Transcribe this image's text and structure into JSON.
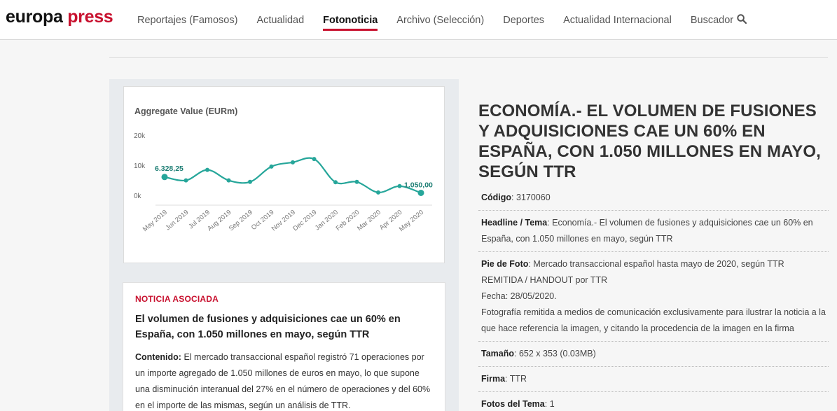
{
  "logo": {
    "part1": "europa ",
    "part2": "press"
  },
  "nav": {
    "items": [
      {
        "label": "Reportajes (Famosos)"
      },
      {
        "label": "Actualidad"
      },
      {
        "label": "Fotonoticia"
      },
      {
        "label": "Archivo (Selección)"
      },
      {
        "label": "Deportes"
      },
      {
        "label": "Actualidad Internacional"
      },
      {
        "label": "Buscador"
      }
    ],
    "active_index": 2
  },
  "chart_data": {
    "type": "line",
    "title": "Aggregate Value (EURm)",
    "categories": [
      "May 2019",
      "Jun 2019",
      "Jul 2019",
      "Aug 2019",
      "Sep 2019",
      "Oct 2019",
      "Nov 2019",
      "Dec 2019",
      "Jan 2020",
      "Feb 2020",
      "Mar 2020",
      "Apr 2020",
      "May 2020"
    ],
    "values": [
      6328.25,
      5200,
      8700,
      5200,
      4700,
      9800,
      11200,
      12300,
      4600,
      4700,
      1200,
      3300,
      1050
    ],
    "ylim": [
      0,
      20000
    ],
    "yticks": [
      "0k",
      "10k",
      "20k"
    ],
    "annotations": [
      {
        "index": 0,
        "label": "6.328,25"
      },
      {
        "index": 12,
        "label": "1.050,00"
      }
    ],
    "grid": false,
    "color": "#26a69a"
  },
  "news": {
    "tag": "NOTICIA ASOCIADA",
    "title": "El volumen de fusiones y adquisiciones cae un 60% en España, con 1.050 millones en mayo, según TTR",
    "content_label": "Contenido:",
    "content": " El mercado transaccional español registró 71 operaciones por un importe agregado de 1.050 millones de euros en mayo, lo que supone una disminución interanual del 27% en el número de operaciones y del 60% en el importe de las mismas, según un análisis de TTR."
  },
  "article": {
    "headline": "ECONOMÍA.- EL VOLUMEN DE FUSIONES Y ADQUISICIONES CAE UN 60% EN ESPAÑA, CON 1.050 MILLONES EN MAYO, SEGÚN TTR",
    "codigo_label": "Código",
    "codigo": ": 3170060",
    "headline_label": "Headline / Tema",
    "headline_value": ": Economía.- El volumen de fusiones y adquisiciones cae un 60% en España, con 1.050 millones en mayo, según TTR",
    "pie_label": "Pie de Foto",
    "pie_line1": ": Mercado transaccional español hasta mayo de 2020, según TTR",
    "pie_line2": "REMITIDA / HANDOUT por TTR",
    "pie_line3": "Fecha: 28/05/2020.",
    "pie_line4": "Fotografía remitida a medios de comunicación exclusivamente para ilustrar la noticia a la que hace referencia la imagen, y citando la procedencia de la imagen en la firma",
    "tamano_label": "Tamaño",
    "tamano": ": 652 x 353 (0.03MB)",
    "firma_label": "Firma",
    "firma": ": TTR",
    "fotos_label": "Fotos del Tema",
    "fotos": ": 1"
  }
}
